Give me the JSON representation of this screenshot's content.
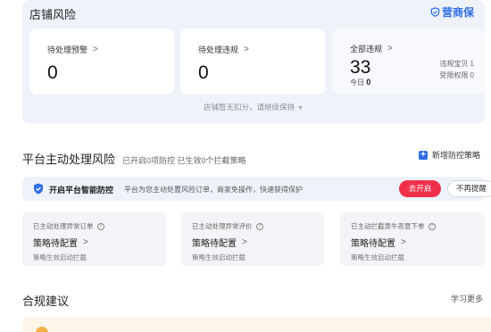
{
  "store_risk": {
    "title": "店铺风险",
    "brand": "营商保",
    "cards": [
      {
        "label": "待处理预警",
        "value": "0"
      },
      {
        "label": "待处理违规",
        "value": "0"
      },
      {
        "label": "全部违规",
        "value": "33",
        "today_label": "今日",
        "today_value": "0",
        "side_stats": [
          "违规宝贝 1",
          "受限权限 0"
        ]
      }
    ],
    "footer": "店铺暂无扣分，请继续保持"
  },
  "platform": {
    "title": "平台主动处理风险",
    "subtitle": "已开启0项防控 已生效0个拦截策略",
    "add_label": "新增防控策略",
    "smart": {
      "title": "开启平台智能防控",
      "desc": "平台为您主动处置风险订单，商家免操作，快速获得保护",
      "enable_label": "去开启",
      "dismiss_label": "不再提醒"
    },
    "items": [
      {
        "label": "已主动处理异常订单",
        "status": "策略待配置",
        "note": "策略生效启动拦截"
      },
      {
        "label": "已主动处理异常评价",
        "status": "策略待配置",
        "note": "策略生效启动拦截"
      },
      {
        "label": "已主动拦截黄牛恶意下单",
        "status": "策略待配置",
        "note": "策略生效启动拦截"
      }
    ]
  },
  "compliance": {
    "title": "合规建议",
    "learn_more": "学习更多"
  },
  "colors": {
    "accent": "#2f6ee6",
    "danger": "#f0304b",
    "panel": "#eef3fb"
  }
}
